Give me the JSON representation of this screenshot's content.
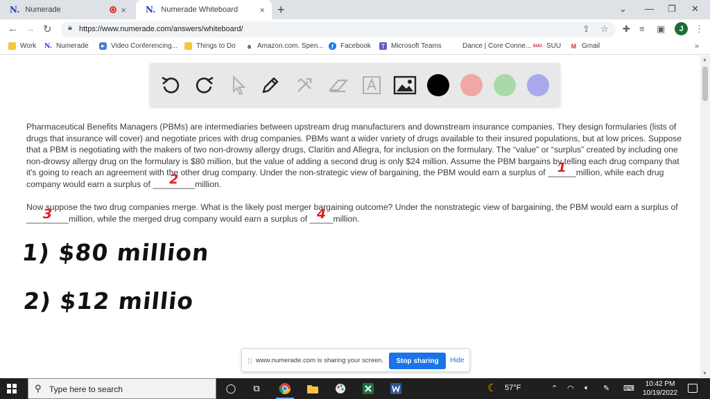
{
  "tabs": [
    {
      "favicon": "N.",
      "title": "Numerade",
      "recording": true,
      "close": "×"
    },
    {
      "favicon": "N.",
      "title": "Numerade Whiteboard",
      "close": "×"
    }
  ],
  "new_tab": "+",
  "window_controls": {
    "minimize": "⌄",
    "restore": "—",
    "maximize": "❐",
    "close": "✕"
  },
  "address_bar": {
    "url": "https://www.numerade.com/answers/whiteboard/"
  },
  "profile_initial": "J",
  "bookmarks": [
    {
      "label": "Work",
      "icon": "folder-icon"
    },
    {
      "label": "Numerade",
      "icon": "numerade-icon"
    },
    {
      "label": "Video Conferencing...",
      "icon": "video-icon"
    },
    {
      "label": "Things to Do",
      "icon": "folder-icon"
    },
    {
      "label": "Amazon.com. Spen...",
      "icon": "amazon-icon"
    },
    {
      "label": "Facebook",
      "icon": "facebook-icon"
    },
    {
      "label": "Microsoft Teams",
      "icon": "teams-icon"
    },
    {
      "label": "Dance | Core Conne...",
      "icon": "blank-icon"
    },
    {
      "label": "SUU",
      "icon": "suu-icon"
    },
    {
      "label": "Gmail",
      "icon": "gmail-icon"
    }
  ],
  "bookmarks_more": "»",
  "whiteboard_tools": {
    "colors": [
      "#000000",
      "#f2a7a7",
      "#a9d8a9",
      "#a9a9ec"
    ]
  },
  "question1": {
    "text_a": "Pharmaceutical Benefits Managers (PBMs) are intermediaries between upstream drug manufacturers and downstream insurance companies. They design formularies (lists of drugs that insurance will cover) and negotiate prices with drug companies. PBMs want a wider variety of drugs available to their insured populations, but at low prices. Suppose that a PBM is negotiating with the makers of two non-drowsy allergy drugs, Claritin and Allegra, for inclusion on the formulary. The “value” or “surplus” created by including one non-drowsy allergy drug on the formulary is $80 million, but the value of adding a second drug is only $24 million. Assume the PBM bargains by telling each drug company that it's going to reach an agreement with the other drug company. Under the non-strategic view of bargaining, the PBM would earn a surplus of",
    "blank1": "______",
    "mark1": "1",
    "text_b": "million, while each drug company would earn a surplus of",
    "blank2": "_________",
    "mark2": "2",
    "text_c": "million."
  },
  "question2": {
    "text_a": "Now suppose the two drug companies merge. What is the likely post merger bargaining outcome? Under the nonstrategic view of bargaining, the PBM would earn a surplus of",
    "blank3": "_________",
    "mark3": "3",
    "text_b": "million, while the merged drug company would earn a surplus of",
    "blank4": "_____",
    "mark4": "4",
    "text_c": "million."
  },
  "handwritten_answers": [
    "1) $80 million",
    "2) $12 millio"
  ],
  "share_bar": {
    "grip": "⁞⁞",
    "message": "www.numerade.com is sharing your screen.",
    "stop_label": "Stop sharing",
    "hide_label": "Hide"
  },
  "taskbar": {
    "search_placeholder": "Type here to search",
    "weather": "57°F",
    "time": "10:42 PM",
    "date": "10/19/2022"
  }
}
